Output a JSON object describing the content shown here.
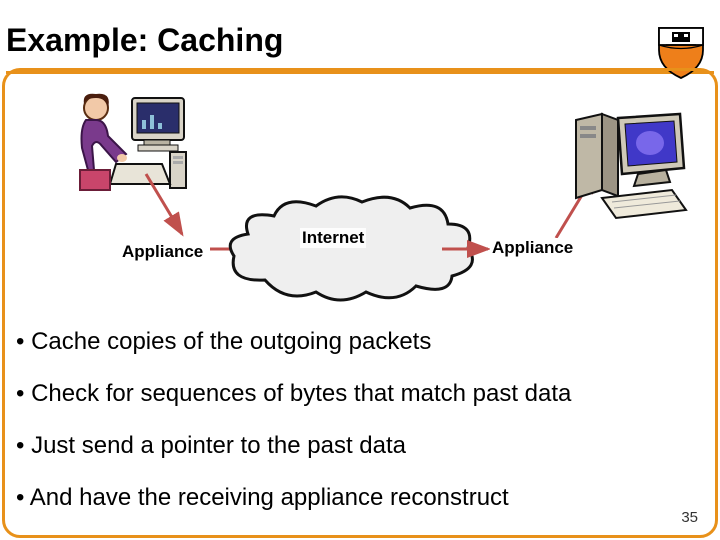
{
  "title": "Example: Caching",
  "labels": {
    "internet": "Internet",
    "appliance_left": "Appliance",
    "appliance_right": "Appliance"
  },
  "bullets": [
    "• Cache copies of the outgoing packets",
    "• Check for sequences of bytes that match past data",
    "• Just send a pointer to the past data",
    "• And have the receiving appliance reconstruct"
  ],
  "page_number": "35"
}
